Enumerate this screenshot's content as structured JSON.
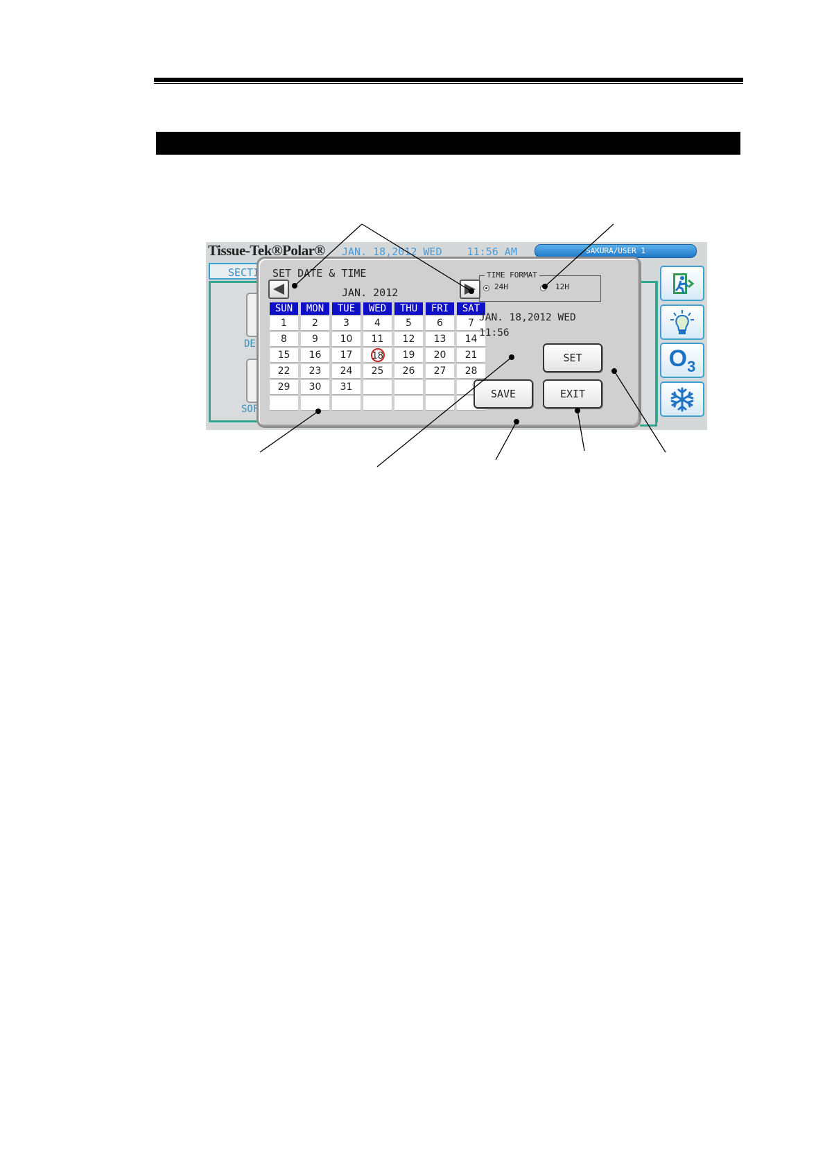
{
  "device": {
    "logo": "Tissue-Tek®Polar®",
    "header_date": "JAN. 18,2012 WED",
    "header_time": "11:56 AM",
    "user": "SAKURA/USER 1",
    "section_tab": "SECTI",
    "bg_labels": [
      "DEF",
      "SOF"
    ]
  },
  "side_icons": [
    "exit-door-icon",
    "light-bulb-icon",
    "ozone-icon",
    "freeze-icon"
  ],
  "ozone_label": "O",
  "ozone_sub": "3",
  "dialog": {
    "title": "SET DATE & TIME",
    "month": "JAN. 2012",
    "weekdays": [
      "SUN",
      "MON",
      "TUE",
      "WED",
      "THU",
      "FRI",
      "SAT"
    ],
    "weeks": [
      [
        "1",
        "2",
        "3",
        "4",
        "5",
        "6",
        "7"
      ],
      [
        "8",
        "9",
        "10",
        "11",
        "12",
        "13",
        "14"
      ],
      [
        "15",
        "16",
        "17",
        "18",
        "19",
        "20",
        "21"
      ],
      [
        "22",
        "23",
        "24",
        "25",
        "26",
        "27",
        "28"
      ],
      [
        "29",
        "30",
        "31",
        "",
        "",
        "",
        ""
      ],
      [
        "",
        "",
        "",
        "",
        "",
        "",
        ""
      ]
    ],
    "selected_day": "18",
    "time_format": {
      "title": "TIME FORMAT",
      "options": [
        "24H",
        "12H"
      ],
      "selected": "24H"
    },
    "current_date": "JAN. 18,2012 WED",
    "current_time": "11:56",
    "set_label": "SET",
    "save_label": "SAVE",
    "exit_label": "EXIT"
  }
}
